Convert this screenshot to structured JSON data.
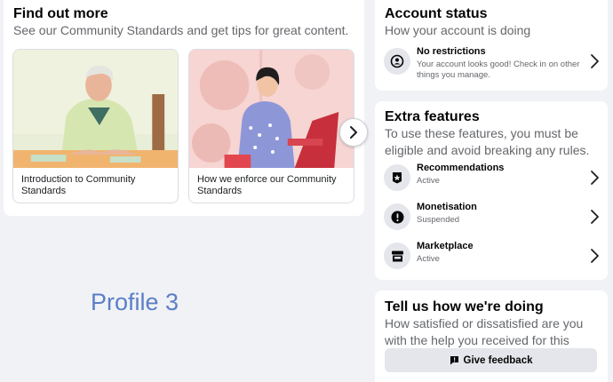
{
  "find_out_more": {
    "title": "Find out more",
    "subtitle": "See our Community Standards and get tips for great content.",
    "articles": [
      {
        "caption": "Introduction to Community Standards",
        "image": "elderly-man-at-table-illustration"
      },
      {
        "caption": "How we enforce our Community Standards",
        "image": "woman-using-laptop-illustration"
      }
    ],
    "next_icon": "chevron-right-icon"
  },
  "profile_label": "Profile 3",
  "account_status": {
    "title": "Account status",
    "subtitle": "How your account is doing",
    "item": {
      "label": "No restrictions",
      "detail": "Your account looks good! Check in on other things you manage.",
      "icon": "user-shield-icon"
    }
  },
  "extra_features": {
    "title": "Extra features",
    "subtitle": "To use these features, you must be eligible and avoid breaking any rules.",
    "items": [
      {
        "label": "Recommendations",
        "status": "Active",
        "icon": "star-badge-icon"
      },
      {
        "label": "Monetisation",
        "status": "Suspended",
        "icon": "alert-icon"
      },
      {
        "label": "Marketplace",
        "status": "Active",
        "icon": "store-icon"
      }
    ]
  },
  "feedback": {
    "title": "Tell us how we're doing",
    "subtitle": "How satisfied or dissatisfied are you with the help you received for this issue?",
    "button_label": "Give feedback",
    "button_icon": "feedback-icon"
  },
  "colors": {
    "page_bg": "#f0f2f5",
    "card_bg": "#ffffff",
    "secondary_text": "#65676b",
    "profile_label": "#5b7fc7",
    "button_bg": "#e4e6eb"
  }
}
